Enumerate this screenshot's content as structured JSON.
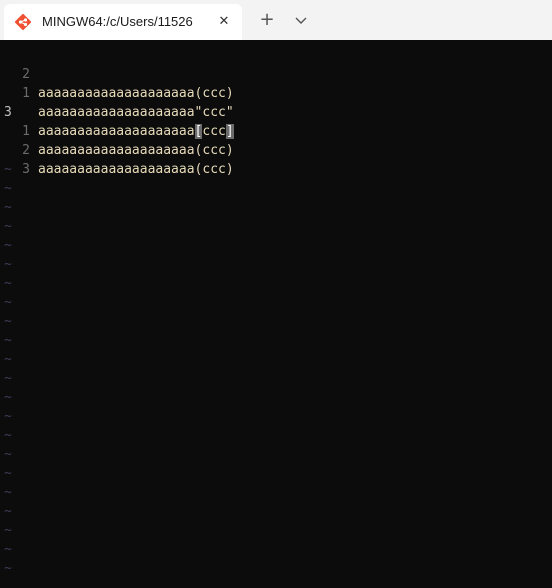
{
  "tab": {
    "title": "MINGW64:/c/Users/11526",
    "close_glyph": "✕",
    "new_tab_glyph": "+",
    "icon": "git-bash-icon",
    "dropdown_icon": "chevron-down-icon"
  },
  "editor": {
    "lines": [
      {
        "num": "2",
        "prefix": "aaaaaaaaaaaaaaaaaaaa",
        "mid": "(ccc)",
        "suffix": ""
      },
      {
        "num": "1",
        "prefix": "aaaaaaaaaaaaaaaaaaaa",
        "mid": "\"ccc\"",
        "suffix": ""
      },
      {
        "num": "3",
        "prefix": "aaaaaaaaaaaaaaaaaaaa",
        "open": "[",
        "mid": "ccc",
        "close": "]"
      },
      {
        "num": "1",
        "prefix": "aaaaaaaaaaaaaaaaaaaa",
        "mid": "(ccc)",
        "suffix": ""
      },
      {
        "num": "2",
        "prefix": "aaaaaaaaaaaaaaaaaaaa",
        "mid": "(ccc)",
        "suffix": ""
      },
      {
        "num": "3",
        "prefix": "",
        "mid": "",
        "suffix": ""
      }
    ],
    "tilde": "~",
    "colors": {
      "text": "#e6d9b8",
      "line_number": "#6c6c6c",
      "current_line_number": "#c0c0c0",
      "tilde": "#3c3c5a",
      "bracket_highlight": "#6b6b6b"
    }
  }
}
